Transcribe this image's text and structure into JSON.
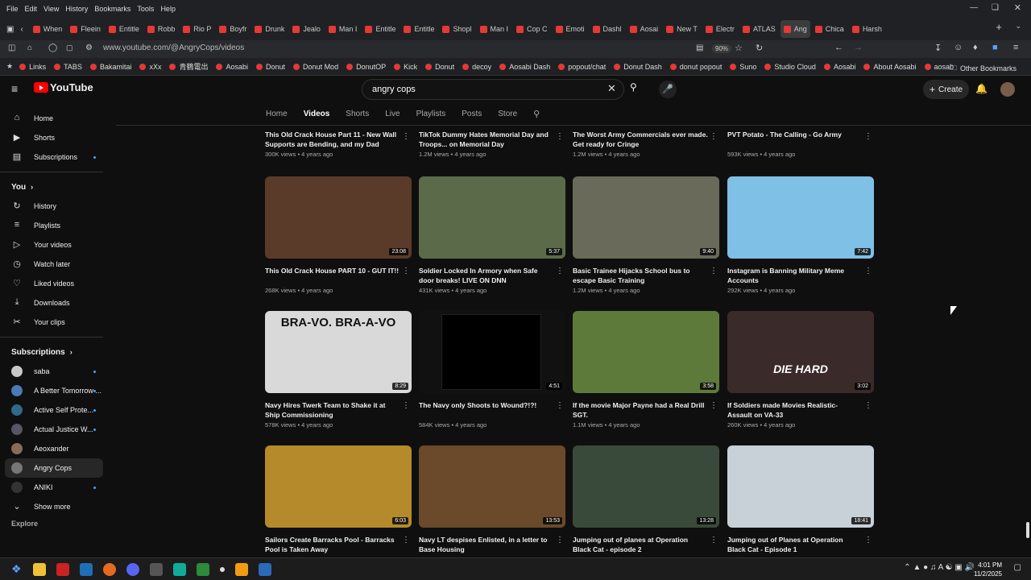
{
  "browser": {
    "menu": [
      "File",
      "Edit",
      "View",
      "History",
      "Bookmarks",
      "Tools",
      "Help"
    ],
    "tabs": [
      "When",
      "Fleein",
      "Entitle",
      "Robb",
      "Rio P",
      "Boyfr",
      "Drunk",
      "Jealo",
      "Man I",
      "Entitle",
      "Entitle",
      "Shopl",
      "Man I",
      "Cop C",
      "Emoti",
      "Dashl",
      "Aosai",
      "New T",
      "Electr",
      "ATLAS",
      "Ang",
      "Chica",
      "Harsh"
    ],
    "url": "www.youtube.com/@AngryCops/videos",
    "zoom": "90%",
    "bookmarks": [
      "Links",
      "TABS",
      "Bakamitai",
      "xXx",
      "青鶴電出",
      "Aosabi",
      "Donut",
      "Donut Mod",
      "DonutOP",
      "Kick",
      "Donut",
      "decoy",
      "Aosabi Dash",
      "popout/chat",
      "Donut Dash",
      "donut popout",
      "Suno",
      "Studio Cloud",
      "Aosabi",
      "About Aosabi",
      "aosab"
    ],
    "other_bookmarks": "Other Bookmarks"
  },
  "header": {
    "logo_text": "YouTube",
    "search_value": "angry cops",
    "create_label": "Create"
  },
  "sidebar": {
    "main": [
      {
        "label": "Home",
        "icon": "home-icon"
      },
      {
        "label": "Shorts",
        "icon": "shorts-icon"
      },
      {
        "label": "Subscriptions",
        "icon": "subscriptions-icon"
      }
    ],
    "you_heading": "You",
    "you": [
      {
        "label": "History",
        "icon": "history-icon"
      },
      {
        "label": "Playlists",
        "icon": "playlists-icon"
      },
      {
        "label": "Your videos",
        "icon": "your-videos-icon"
      },
      {
        "label": "Watch later",
        "icon": "watch-later-icon"
      },
      {
        "label": "Liked videos",
        "icon": "liked-icon"
      },
      {
        "label": "Downloads",
        "icon": "download-icon"
      },
      {
        "label": "Your clips",
        "icon": "clips-icon"
      }
    ],
    "subs_heading": "Subscriptions",
    "subs": [
      {
        "label": "saba",
        "color": "#c7c7c7"
      },
      {
        "label": "A Better Tomorrow ...",
        "color": "#4a7ab8"
      },
      {
        "label": "Active Self Prote...",
        "color": "#2f6a8a"
      },
      {
        "label": "Actual Justice W...",
        "color": "#556"
      },
      {
        "label": "Aeoxander",
        "color": "#8a6a5a"
      },
      {
        "label": "Angry Cops",
        "color": "#777"
      },
      {
        "label": "ANIKI",
        "color": "#333"
      }
    ],
    "show_more": "Show more",
    "explore": "Explore"
  },
  "channel_tabs": [
    "Home",
    "Videos",
    "Shorts",
    "Live",
    "Playlists",
    "Posts",
    "Store"
  ],
  "videos": [
    {
      "title": "This Old Crack House Part 11 - New Wall Supports are Bending, and my Dad Shows...",
      "views": "300K views",
      "age": "4 years ago",
      "duration": "",
      "thumb": ""
    },
    {
      "title": "TikTok Dummy Hates Memorial Day and Troops... on Memorial Day",
      "views": "1.2M views",
      "age": "4 years ago",
      "duration": "",
      "thumb": ""
    },
    {
      "title": "The Worst Army Commercials ever made. Get ready for Cringe",
      "views": "1.2M views",
      "age": "4 years ago",
      "duration": "",
      "thumb": ""
    },
    {
      "title": "PVT Potato - The Calling - Go Army",
      "views": "593K views",
      "age": "4 years ago",
      "duration": "",
      "thumb": ""
    },
    {
      "title": "This Old Crack House PART 10 - GUT IT!!",
      "views": "268K views",
      "age": "4 years ago",
      "duration": "23:08",
      "thumb": "#5a3b2a"
    },
    {
      "title": "Soldier Locked In Armory when Safe door breaks! LIVE ON DNN",
      "views": "431K views",
      "age": "4 years ago",
      "duration": "5:37",
      "thumb": "#5b6b4a"
    },
    {
      "title": "Basic Trainee Hijacks School bus to escape Basic Training",
      "views": "1.2M views",
      "age": "4 years ago",
      "duration": "9:40",
      "thumb": "#6a6a5a"
    },
    {
      "title": "Instagram is Banning Military Meme Accounts",
      "views": "292K views",
      "age": "4 years ago",
      "duration": "7:42",
      "thumb": "#7ec0e6"
    },
    {
      "title": "Navy Hires Twerk Team to Shake it at Ship Commissioning",
      "views": "578K views",
      "age": "4 years ago",
      "duration": "8:29",
      "thumb": "#d9d9d9",
      "overlay": "BRA-VO.  BRA-A-VO"
    },
    {
      "title": "The Navy only Shoots to Wound?!?!",
      "views": "584K views",
      "age": "4 years ago",
      "duration": "4:51",
      "thumb": "#111",
      "overlay": ""
    },
    {
      "title": "If the movie Major Payne had a Real Drill SGT.",
      "views": "1.1M views",
      "age": "4 years ago",
      "duration": "3:58",
      "thumb": "#5e7a3a"
    },
    {
      "title": "If Soldiers made Movies Realistic- Assault on VA-33",
      "views": "260K views",
      "age": "4 years ago",
      "duration": "3:02",
      "thumb": "#3b2a2a",
      "overlay": "DIE HARD"
    },
    {
      "title": "Sailors Create Barracks Pool - Barracks Pool is Taken Away",
      "views": "",
      "age": "",
      "duration": "6:03",
      "thumb": "#b58a2a"
    },
    {
      "title": "Navy LT despises Enlisted, in a letter to Base Housing",
      "views": "",
      "age": "",
      "duration": "13:53",
      "thumb": "#6a4a2a"
    },
    {
      "title": "Jumping out of planes at Operation Black Cat - episode 2",
      "views": "",
      "age": "",
      "duration": "13:28",
      "thumb": "#3a4a3a"
    },
    {
      "title": "Jumping out of Planes at Operation Black Cat - Episode 1",
      "views": "",
      "age": "",
      "duration": "18:41",
      "thumb": "#c8d0d8"
    }
  ],
  "taskbar": {
    "time": "4:01 PM",
    "date": "11/2/2025"
  }
}
